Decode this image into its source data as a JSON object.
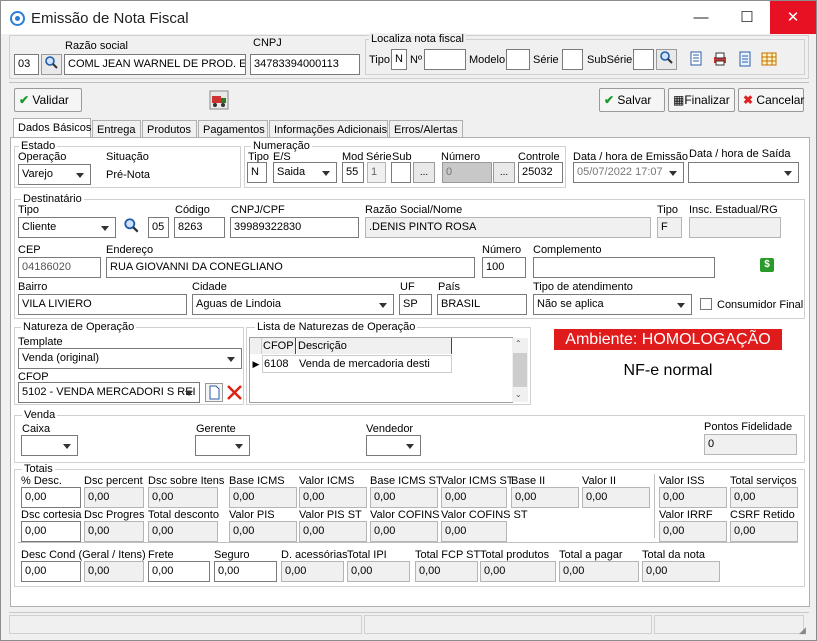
{
  "window": {
    "title": "Emissão de Nota Fiscal",
    "minimize": "—",
    "maximize": "☐",
    "close": "✕"
  },
  "header": {
    "razao_label": "Razão social",
    "cnpj_label": "CNPJ",
    "code": "03",
    "razao": "COML JEAN WARNEL DE PROD. ESP.",
    "cnpj": "34783394000113",
    "localiza_label": "Localiza nota fiscal",
    "tipo_label": "Tipo",
    "tipo": "N",
    "n_label": "Nº",
    "modelo_label": "Modelo",
    "serie_label": "Série",
    "subserie_label": "SubSérie"
  },
  "toolbar": {
    "validar": "Validar",
    "salvar": "Salvar",
    "finalizar": "Finalizar",
    "cancelar": "Cancelar"
  },
  "tabs": [
    "Dados Básicos",
    "Entrega",
    "Produtos",
    "Pagamentos",
    "Informações Adicionais",
    "Erros/Alertas"
  ],
  "estado": {
    "title": "Estado",
    "operacao_label": "Operação",
    "operacao": "Varejo",
    "situacao_label": "Situação",
    "situacao": "Pré-Nota"
  },
  "numeracao": {
    "title": "Numeração",
    "tipo_label": "Tipo",
    "tipo": "N",
    "es_label": "E/S",
    "es": "Saida",
    "mod_label": "Mod",
    "mod": "55",
    "serie_label": "Série",
    "serie": "1",
    "sub_label": "Sub",
    "numero_label": "Número",
    "numero": "0",
    "controle_label": "Controle",
    "controle": "25032",
    "ellipsis": "..."
  },
  "datas": {
    "emissao_label": "Data / hora de Emissão",
    "emissao": "05/07/2022 17:07",
    "saida_label": "Data / hora de Saída",
    "saida": ""
  },
  "destinatario": {
    "title": "Destinatário",
    "tipo_label": "Tipo",
    "tipo": "Cliente",
    "codigo_label": "Código",
    "codigo_prefix": "05",
    "codigo": "8263",
    "cnpj_label": "CNPJ/CPF",
    "cnpj": "39989322830",
    "razao_label": "Razão Social/Nome",
    "razao": ".DENIS PINTO ROSA",
    "tipo2_label": "Tipo",
    "tipo2": "F",
    "ie_label": "Insc. Estadual/RG",
    "ie": "",
    "cep_label": "CEP",
    "cep": "04186020",
    "endereco_label": "Endereço",
    "endereco": "RUA GIOVANNI DA CONEGLIANO",
    "numero_label": "Número",
    "numero": "100",
    "complemento_label": "Complemento",
    "complemento": "",
    "bairro_label": "Bairro",
    "bairro": "VILA LIVIERO",
    "cidade_label": "Cidade",
    "cidade": "Aguas de Lindoia",
    "uf_label": "UF",
    "uf": "SP",
    "pais_label": "País",
    "pais": "BRASIL",
    "atendimento_label": "Tipo de atendimento",
    "atendimento": "Não se aplica",
    "consumidor_label": "Consumidor Final"
  },
  "natureza": {
    "title": "Natureza de Operação",
    "template_label": "Template",
    "template": "Venda (original)",
    "cfop_label": "CFOP",
    "cfop": "5102  - VENDA MERCADORI S REI"
  },
  "lista": {
    "title": "Lista de Naturezas de Operação",
    "col_cfop": "CFOP",
    "col_desc": "Descrição",
    "rows": [
      {
        "cfop": "6108",
        "desc": "Venda de mercadoria desti"
      }
    ]
  },
  "ambiente": {
    "badge": "Ambiente: HOMOLOGAÇÃO",
    "tipo": "NF-e normal",
    "badge_color": "#e01b1b"
  },
  "venda": {
    "title": "Venda",
    "caixa_label": "Caixa",
    "gerente_label": "Gerente",
    "vendedor_label": "Vendedor",
    "pontos_label": "Pontos Fidelidade",
    "pontos": "0"
  },
  "totais": {
    "title": "Totais",
    "row1": [
      {
        "label": "% Desc.",
        "value": "0,00"
      },
      {
        "label": "Dsc percent",
        "value": "0,00"
      },
      {
        "label": "Dsc sobre Itens",
        "value": "0,00"
      },
      {
        "label": "Base ICMS",
        "value": "0,00"
      },
      {
        "label": "Valor ICMS",
        "value": "0,00"
      },
      {
        "label": "Base ICMS ST",
        "value": "0,00"
      },
      {
        "label": "Valor ICMS ST",
        "value": "0,00"
      },
      {
        "label": "Base II",
        "value": "0,00"
      },
      {
        "label": "Valor II",
        "value": "0,00"
      },
      {
        "label": "Valor ISS",
        "value": "0,00"
      },
      {
        "label": "Total serviços",
        "value": "0,00"
      }
    ],
    "row2": [
      {
        "label": "Dsc cortesia",
        "value": "0,00"
      },
      {
        "label": "Dsc Progres",
        "value": "0,00"
      },
      {
        "label": "Total desconto",
        "value": "0,00"
      },
      {
        "label": "Valor PIS",
        "value": "0,00"
      },
      {
        "label": "Valor PIS ST",
        "value": "0,00"
      },
      {
        "label": "Valor COFINS",
        "value": "0,00"
      },
      {
        "label": "Valor COFINS ST",
        "value": "0,00"
      },
      {
        "label": "Valor IRRF",
        "value": "0,00"
      },
      {
        "label": "CSRF Retido",
        "value": "0,00"
      }
    ],
    "row3": [
      {
        "label": "Desc Cond (Geral / Itens)",
        "value": "0,00"
      },
      {
        "label": "",
        "value": "0,00"
      },
      {
        "label": "Frete",
        "value": "0,00"
      },
      {
        "label": "Seguro",
        "value": "0,00"
      },
      {
        "label": "D. acessórias",
        "value": "0,00"
      },
      {
        "label": "Total IPI",
        "value": "0,00"
      },
      {
        "label": "Total FCP ST",
        "value": "0,00"
      },
      {
        "label": "Total produtos",
        "value": "0,00"
      },
      {
        "label": "Total a pagar",
        "value": "0,00"
      },
      {
        "label": "Total da nota",
        "value": "0,00"
      }
    ]
  }
}
